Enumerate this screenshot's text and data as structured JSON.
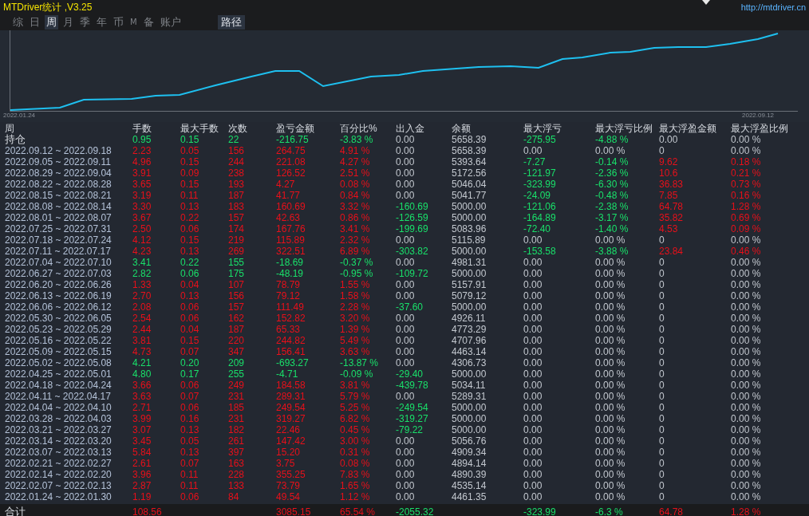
{
  "window": {
    "title": "MTDriver统计 ,V3.25",
    "url": "http://mtdriver.cn"
  },
  "tabs": [
    {
      "label": "综",
      "selected": false
    },
    {
      "label": "日",
      "selected": false
    },
    {
      "label": "周",
      "selected": true
    },
    {
      "label": "月",
      "selected": false
    },
    {
      "label": "季",
      "selected": false
    },
    {
      "label": "年",
      "selected": false
    },
    {
      "label": "币",
      "selected": false
    },
    {
      "label": "M",
      "selected": false
    },
    {
      "label": "备",
      "selected": false
    },
    {
      "label": "账户",
      "selected": false
    }
  ],
  "path_button": "路径",
  "chart": {
    "start_label": "2022.01.24",
    "end_label": "2022.09.12"
  },
  "table": {
    "columns": [
      "周",
      "手数",
      "最大手数",
      "次数",
      "盈亏金额",
      "百分比%",
      "出入金",
      "余额",
      "最大浮亏",
      "最大浮亏比例",
      "最大浮盈金额",
      "最大浮盈比例"
    ],
    "rows": [
      {
        "cells": [
          "持仓",
          "0.95",
          "0.15",
          "22",
          "-216.75",
          "-3.83 %",
          "0.00",
          "5658.39",
          "-275.95",
          "-4.88 %",
          "0.00",
          "0.00 %"
        ],
        "gain": false,
        "deposit_out": false,
        "drawdown": true,
        "float_profit": false
      },
      {
        "cells": [
          "2022.09.12 ~ 2022.09.18",
          "2.23",
          "0.05",
          "156",
          "264.75",
          "4.91 %",
          "0.00",
          "5658.39",
          "0.00",
          "0.00 %",
          "0",
          "0.00 %"
        ],
        "gain": true,
        "deposit_out": false,
        "drawdown": false,
        "float_profit": false
      },
      {
        "cells": [
          "2022.09.05 ~ 2022.09.11",
          "4.96",
          "0.15",
          "244",
          "221.08",
          "4.27 %",
          "0.00",
          "5393.64",
          "-7.27",
          "-0.14 %",
          "9.62",
          "0.18 %"
        ],
        "gain": true,
        "deposit_out": false,
        "drawdown": true,
        "float_profit": true
      },
      {
        "cells": [
          "2022.08.29 ~ 2022.09.04",
          "3.91",
          "0.09",
          "238",
          "126.52",
          "2.51 %",
          "0.00",
          "5172.56",
          "-121.97",
          "-2.36 %",
          "10.6",
          "0.21 %"
        ],
        "gain": true,
        "deposit_out": false,
        "drawdown": true,
        "float_profit": true
      },
      {
        "cells": [
          "2022.08.22 ~ 2022.08.28",
          "3.65",
          "0.15",
          "193",
          "4.27",
          "0.08 %",
          "0.00",
          "5046.04",
          "-323.99",
          "-6.30 %",
          "36.83",
          "0.73 %"
        ],
        "gain": true,
        "deposit_out": false,
        "drawdown": true,
        "float_profit": true
      },
      {
        "cells": [
          "2022.08.15 ~ 2022.08.21",
          "3.19",
          "0.11",
          "187",
          "41.77",
          "0.84 %",
          "0.00",
          "5041.77",
          "-24.09",
          "-0.48 %",
          "7.85",
          "0.16 %"
        ],
        "gain": true,
        "deposit_out": false,
        "drawdown": true,
        "float_profit": true
      },
      {
        "cells": [
          "2022.08.08 ~ 2022.08.14",
          "3.30",
          "0.13",
          "183",
          "160.69",
          "3.32 %",
          "-160.69",
          "5000.00",
          "-121.06",
          "-2.38 %",
          "64.78",
          "1.28 %"
        ],
        "gain": true,
        "deposit_out": true,
        "drawdown": true,
        "float_profit": true
      },
      {
        "cells": [
          "2022.08.01 ~ 2022.08.07",
          "3.67",
          "0.22",
          "157",
          "42.63",
          "0.86 %",
          "-126.59",
          "5000.00",
          "-164.89",
          "-3.17 %",
          "35.82",
          "0.69 %"
        ],
        "gain": true,
        "deposit_out": true,
        "drawdown": true,
        "float_profit": true
      },
      {
        "cells": [
          "2022.07.25 ~ 2022.07.31",
          "2.50",
          "0.06",
          "174",
          "167.76",
          "3.41 %",
          "-199.69",
          "5083.96",
          "-72.40",
          "-1.40 %",
          "4.53",
          "0.09 %"
        ],
        "gain": true,
        "deposit_out": true,
        "drawdown": true,
        "float_profit": true
      },
      {
        "cells": [
          "2022.07.18 ~ 2022.07.24",
          "4.12",
          "0.15",
          "219",
          "115.89",
          "2.32 %",
          "0.00",
          "5115.89",
          "0.00",
          "0.00 %",
          "0",
          "0.00 %"
        ],
        "gain": true,
        "deposit_out": false,
        "drawdown": false,
        "float_profit": false
      },
      {
        "cells": [
          "2022.07.11 ~ 2022.07.17",
          "4.23",
          "0.13",
          "269",
          "322.51",
          "6.89 %",
          "-303.82",
          "5000.00",
          "-153.58",
          "-3.88 %",
          "23.84",
          "0.46 %"
        ],
        "gain": true,
        "deposit_out": true,
        "drawdown": true,
        "float_profit": true
      },
      {
        "cells": [
          "2022.07.04 ~ 2022.07.10",
          "3.41",
          "0.22",
          "155",
          "-18.69",
          "-0.37 %",
          "0.00",
          "4981.31",
          "0.00",
          "0.00 %",
          "0",
          "0.00 %"
        ],
        "gain": false,
        "deposit_out": false,
        "drawdown": false,
        "float_profit": false
      },
      {
        "cells": [
          "2022.06.27 ~ 2022.07.03",
          "2.82",
          "0.06",
          "175",
          "-48.19",
          "-0.95 %",
          "-109.72",
          "5000.00",
          "0.00",
          "0.00 %",
          "0",
          "0.00 %"
        ],
        "gain": false,
        "deposit_out": true,
        "drawdown": false,
        "float_profit": false
      },
      {
        "cells": [
          "2022.06.20 ~ 2022.06.26",
          "1.33",
          "0.04",
          "107",
          "78.79",
          "1.55 %",
          "0.00",
          "5157.91",
          "0.00",
          "0.00 %",
          "0",
          "0.00 %"
        ],
        "gain": true,
        "deposit_out": false,
        "drawdown": false,
        "float_profit": false
      },
      {
        "cells": [
          "2022.06.13 ~ 2022.06.19",
          "2.70",
          "0.13",
          "156",
          "79.12",
          "1.58 %",
          "0.00",
          "5079.12",
          "0.00",
          "0.00 %",
          "0",
          "0.00 %"
        ],
        "gain": true,
        "deposit_out": false,
        "drawdown": false,
        "float_profit": false
      },
      {
        "cells": [
          "2022.06.06 ~ 2022.06.12",
          "2.08",
          "0.06",
          "157",
          "111.49",
          "2.28 %",
          "-37.60",
          "5000.00",
          "0.00",
          "0.00 %",
          "0",
          "0.00 %"
        ],
        "gain": true,
        "deposit_out": true,
        "drawdown": false,
        "float_profit": false
      },
      {
        "cells": [
          "2022.05.30 ~ 2022.06.05",
          "2.54",
          "0.06",
          "162",
          "152.82",
          "3.20 %",
          "0.00",
          "4926.11",
          "0.00",
          "0.00 %",
          "0",
          "0.00 %"
        ],
        "gain": true,
        "deposit_out": false,
        "drawdown": false,
        "float_profit": false
      },
      {
        "cells": [
          "2022.05.23 ~ 2022.05.29",
          "2.44",
          "0.04",
          "187",
          "65.33",
          "1.39 %",
          "0.00",
          "4773.29",
          "0.00",
          "0.00 %",
          "0",
          "0.00 %"
        ],
        "gain": true,
        "deposit_out": false,
        "drawdown": false,
        "float_profit": false
      },
      {
        "cells": [
          "2022.05.16 ~ 2022.05.22",
          "3.81",
          "0.15",
          "220",
          "244.82",
          "5.49 %",
          "0.00",
          "4707.96",
          "0.00",
          "0.00 %",
          "0",
          "0.00 %"
        ],
        "gain": true,
        "deposit_out": false,
        "drawdown": false,
        "float_profit": false
      },
      {
        "cells": [
          "2022.05.09 ~ 2022.05.15",
          "4.73",
          "0.07",
          "347",
          "156.41",
          "3.63 %",
          "0.00",
          "4463.14",
          "0.00",
          "0.00 %",
          "0",
          "0.00 %"
        ],
        "gain": true,
        "deposit_out": false,
        "drawdown": false,
        "float_profit": false
      },
      {
        "cells": [
          "2022.05.02 ~ 2022.05.08",
          "4.21",
          "0.20",
          "209",
          "-693.27",
          "-13.87 %",
          "0.00",
          "4306.73",
          "0.00",
          "0.00 %",
          "0",
          "0.00 %"
        ],
        "gain": false,
        "deposit_out": false,
        "drawdown": false,
        "float_profit": false
      },
      {
        "cells": [
          "2022.04.25 ~ 2022.05.01",
          "4.80",
          "0.17",
          "255",
          "-4.71",
          "-0.09 %",
          "-29.40",
          "5000.00",
          "0.00",
          "0.00 %",
          "0",
          "0.00 %"
        ],
        "gain": false,
        "deposit_out": true,
        "drawdown": false,
        "float_profit": false
      },
      {
        "cells": [
          "2022.04.18 ~ 2022.04.24",
          "3.66",
          "0.06",
          "249",
          "184.58",
          "3.81 %",
          "-439.78",
          "5034.11",
          "0.00",
          "0.00 %",
          "0",
          "0.00 %"
        ],
        "gain": true,
        "deposit_out": true,
        "drawdown": false,
        "float_profit": false
      },
      {
        "cells": [
          "2022.04.11 ~ 2022.04.17",
          "3.63",
          "0.07",
          "231",
          "289.31",
          "5.79 %",
          "0.00",
          "5289.31",
          "0.00",
          "0.00 %",
          "0",
          "0.00 %"
        ],
        "gain": true,
        "deposit_out": false,
        "drawdown": false,
        "float_profit": false
      },
      {
        "cells": [
          "2022.04.04 ~ 2022.04.10",
          "2.71",
          "0.06",
          "185",
          "249.54",
          "5.25 %",
          "-249.54",
          "5000.00",
          "0.00",
          "0.00 %",
          "0",
          "0.00 %"
        ],
        "gain": true,
        "deposit_out": true,
        "drawdown": false,
        "float_profit": false
      },
      {
        "cells": [
          "2022.03.28 ~ 2022.04.03",
          "3.99",
          "0.16",
          "231",
          "319.27",
          "6.82 %",
          "-319.27",
          "5000.00",
          "0.00",
          "0.00 %",
          "0",
          "0.00 %"
        ],
        "gain": true,
        "deposit_out": true,
        "drawdown": false,
        "float_profit": false
      },
      {
        "cells": [
          "2022.03.21 ~ 2022.03.27",
          "3.07",
          "0.13",
          "182",
          "22.46",
          "0.45 %",
          "-79.22",
          "5000.00",
          "0.00",
          "0.00 %",
          "0",
          "0.00 %"
        ],
        "gain": true,
        "deposit_out": true,
        "drawdown": false,
        "float_profit": false
      },
      {
        "cells": [
          "2022.03.14 ~ 2022.03.20",
          "3.45",
          "0.05",
          "261",
          "147.42",
          "3.00 %",
          "0.00",
          "5056.76",
          "0.00",
          "0.00 %",
          "0",
          "0.00 %"
        ],
        "gain": true,
        "deposit_out": false,
        "drawdown": false,
        "float_profit": false
      },
      {
        "cells": [
          "2022.03.07 ~ 2022.03.13",
          "5.84",
          "0.13",
          "397",
          "15.20",
          "0.31 %",
          "0.00",
          "4909.34",
          "0.00",
          "0.00 %",
          "0",
          "0.00 %"
        ],
        "gain": true,
        "deposit_out": false,
        "drawdown": false,
        "float_profit": false
      },
      {
        "cells": [
          "2022.02.21 ~ 2022.02.27",
          "2.61",
          "0.07",
          "163",
          "3.75",
          "0.08 %",
          "0.00",
          "4894.14",
          "0.00",
          "0.00 %",
          "0",
          "0.00 %"
        ],
        "gain": true,
        "deposit_out": false,
        "drawdown": false,
        "float_profit": false
      },
      {
        "cells": [
          "2022.02.14 ~ 2022.02.20",
          "3.96",
          "0.11",
          "228",
          "355.25",
          "7.83 %",
          "0.00",
          "4890.39",
          "0.00",
          "0.00 %",
          "0",
          "0.00 %"
        ],
        "gain": true,
        "deposit_out": false,
        "drawdown": false,
        "float_profit": false
      },
      {
        "cells": [
          "2022.02.07 ~ 2022.02.13",
          "2.87",
          "0.11",
          "133",
          "73.79",
          "1.65 %",
          "0.00",
          "4535.14",
          "0.00",
          "0.00 %",
          "0",
          "0.00 %"
        ],
        "gain": true,
        "deposit_out": false,
        "drawdown": false,
        "float_profit": false
      },
      {
        "cells": [
          "2022.01.24 ~ 2022.01.30",
          "1.19",
          "0.06",
          "84",
          "49.54",
          "1.12 %",
          "0.00",
          "4461.35",
          "0.00",
          "0.00 %",
          "0",
          "0.00 %"
        ],
        "gain": true,
        "deposit_out": false,
        "drawdown": false,
        "float_profit": false
      }
    ],
    "total": {
      "cells": [
        "合计",
        "108.56",
        null,
        null,
        "3085.15",
        "65.54 %",
        "-2055.32",
        null,
        "-323.99",
        "-6.3 %",
        "64.78",
        "1.28 %"
      ],
      "gain": true,
      "deposit_out": true,
      "drawdown": true,
      "float_profit": true
    }
  }
}
